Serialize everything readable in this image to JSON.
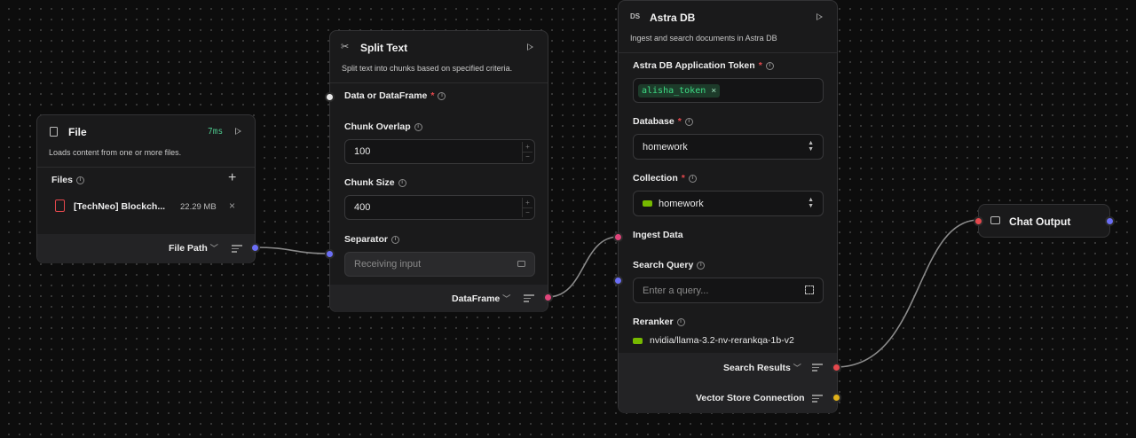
{
  "file_node": {
    "title": "File",
    "timing": "7ms",
    "description": "Loads content from one or more files.",
    "files_label": "Files",
    "file_name": "[TechNeo] Blockch...",
    "file_size": "22.29 MB",
    "output_label": "File Path"
  },
  "split_node": {
    "title": "Split Text",
    "description": "Split text into chunks based on specified criteria.",
    "input_label": "Data or DataFrame",
    "chunk_overlap_label": "Chunk Overlap",
    "chunk_overlap_value": "100",
    "chunk_size_label": "Chunk Size",
    "chunk_size_value": "400",
    "separator_label": "Separator",
    "separator_placeholder": "Receiving input",
    "output_label": "DataFrame"
  },
  "astra_node": {
    "title": "Astra DB",
    "description": "Ingest and search documents in Astra DB",
    "token_label": "Astra DB Application Token",
    "token_value": "alisha_token",
    "database_label": "Database",
    "database_value": "homework",
    "collection_label": "Collection",
    "collection_value": "homework",
    "ingest_label": "Ingest Data",
    "search_query_label": "Search Query",
    "search_query_placeholder": "Enter a query...",
    "reranker_label": "Reranker",
    "reranker_value": "nvidia/llama-3.2-nv-rerankqa-1b-v2",
    "output_search_label": "Search Results",
    "output_vector_label": "Vector Store Connection"
  },
  "chat_node": {
    "title": "Chat Output"
  },
  "colors": {
    "canvas": "#0d0d0d",
    "node_bg": "#1a1a1b",
    "handle_blue": "#6b6ef5",
    "handle_pink": "#e0457b",
    "handle_red": "#e5484d",
    "handle_yellow": "#e0b11a",
    "timing_green": "#4cc38a",
    "token_green": "#3ddc84"
  }
}
